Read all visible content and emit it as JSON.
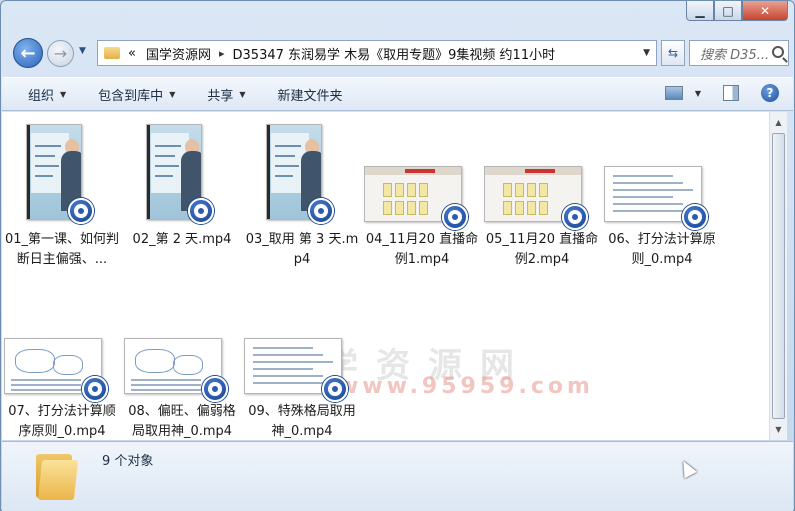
{
  "window": {
    "controls": {
      "minimize": "▁",
      "maximize": "□",
      "close": "✕"
    }
  },
  "nav": {
    "back_glyph": "←",
    "forward_glyph": "→",
    "history_glyph": "▼",
    "breadcrumb_overflow": "«",
    "breadcrumbs": [
      "国学资源网",
      "D35347 东润易学 木易《取用专题》9集视频 约11小时"
    ],
    "separator": "▸",
    "dropdown_glyph": "▼",
    "refresh_glyph": "⇆",
    "search_placeholder": "搜索 D35..."
  },
  "toolbar": {
    "organize": "组织",
    "include_library": "包含到库中",
    "share": "共享",
    "new_folder": "新建文件夹",
    "caret": "▼",
    "help_glyph": "?"
  },
  "files": [
    {
      "name": "01_第一课、如何判断日主偏强、...",
      "thumb": "portrait"
    },
    {
      "name": "02_第 2 天.mp4",
      "thumb": "portrait"
    },
    {
      "name": "03_取用 第 3 天.mp4",
      "thumb": "portrait"
    },
    {
      "name": "04_11月20 直播命例1.mp4",
      "thumb": "screen"
    },
    {
      "name": "05_11月20 直播命例2.mp4",
      "thumb": "screen"
    },
    {
      "name": "06、打分法计算原则_0.mp4",
      "thumb": "doc"
    },
    {
      "name": "07、打分法计算顺序原则_0.mp4",
      "thumb": "sketch"
    },
    {
      "name": "08、偏旺、偏弱格局取用神_0.mp4",
      "thumb": "sketch"
    },
    {
      "name": "09、特殊格局取用神_0.mp4",
      "thumb": "doc"
    }
  ],
  "watermark": {
    "text": "国学资源网",
    "url": "www.95959.com"
  },
  "status": {
    "count": "9 个对象"
  },
  "scrollbar": {
    "up": "▲",
    "down": "▼"
  }
}
